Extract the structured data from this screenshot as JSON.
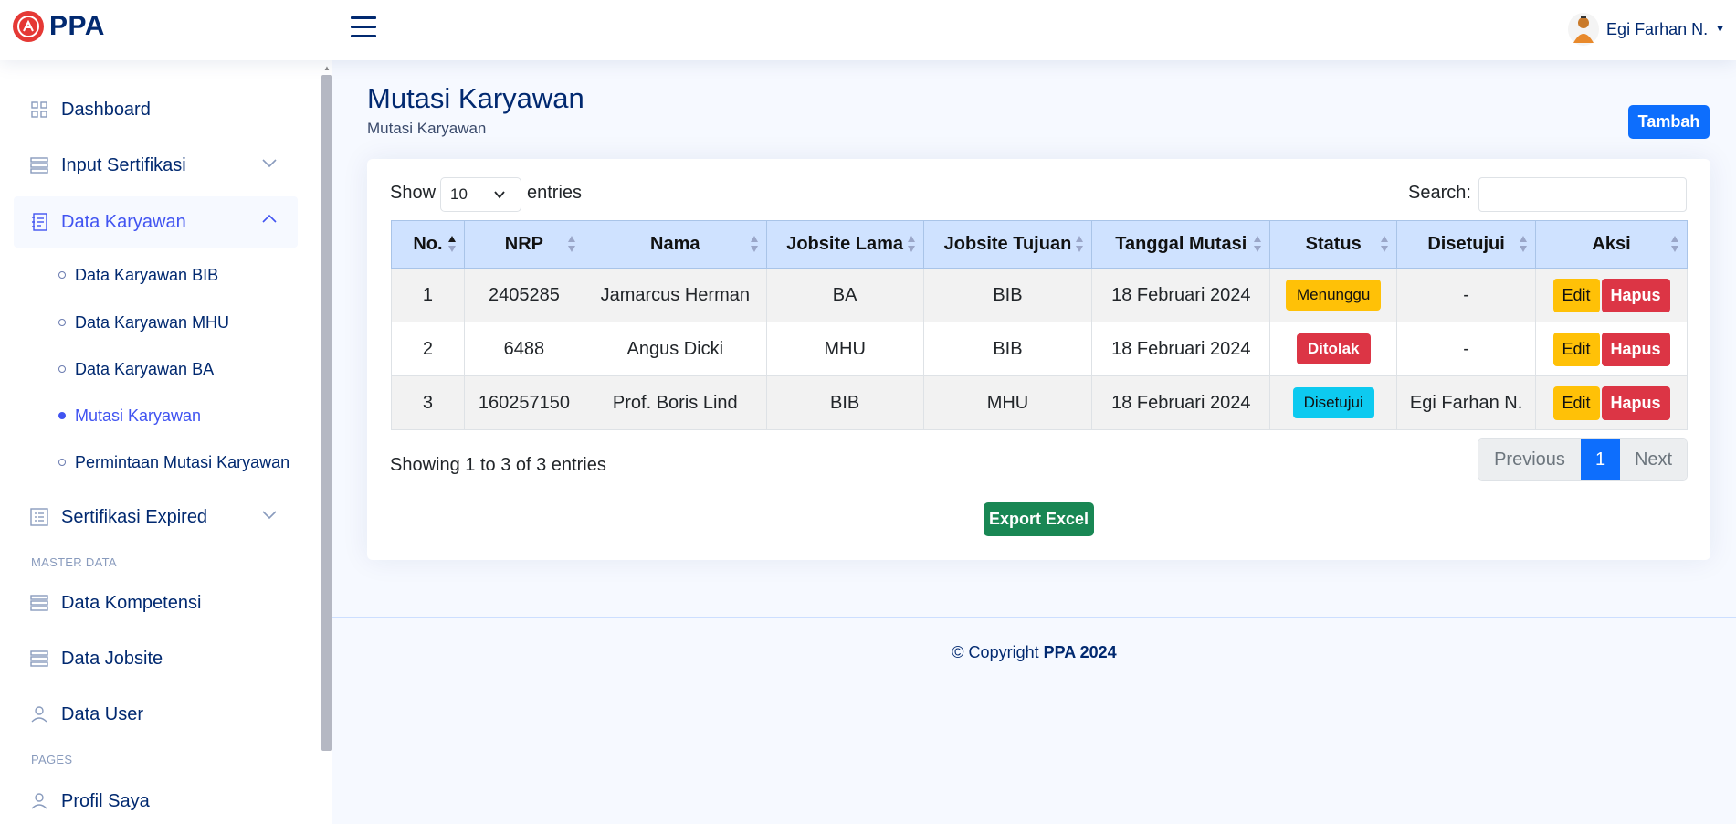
{
  "header": {
    "brand": "PPA",
    "user_name": "Egi Farhan N."
  },
  "sidebar": {
    "items": [
      {
        "label": "Dashboard",
        "icon": "grid-icon"
      },
      {
        "label": "Input Sertifikasi",
        "icon": "server-icon"
      },
      {
        "label": "Data Karyawan",
        "icon": "journal-icon"
      },
      {
        "label": "Sertifikasi Expired",
        "icon": "list-icon"
      }
    ],
    "sub_items": [
      {
        "label": "Data Karyawan BIB"
      },
      {
        "label": "Data Karyawan MHU"
      },
      {
        "label": "Data Karyawan BA"
      },
      {
        "label": "Mutasi Karyawan"
      },
      {
        "label": "Permintaan Mutasi Karyawan"
      }
    ],
    "master_heading": "MASTER DATA",
    "master_items": [
      {
        "label": "Data Kompetensi",
        "icon": "server-icon"
      },
      {
        "label": "Data Jobsite",
        "icon": "server-icon"
      },
      {
        "label": "Data User",
        "icon": "person-icon"
      }
    ],
    "pages_heading": "PAGES",
    "pages_items": [
      {
        "label": "Profil Saya",
        "icon": "person-icon"
      }
    ]
  },
  "main": {
    "title": "Mutasi Karyawan",
    "subtitle": "Mutasi Karyawan",
    "add_button": "Tambah"
  },
  "table_controls": {
    "show_label": "Show",
    "entries_value": "10",
    "entries_label": "entries",
    "search_label": "Search:"
  },
  "table": {
    "headers": [
      "No.",
      "NRP",
      "Nama",
      "Jobsite Lama",
      "Jobsite Tujuan",
      "Tanggal Mutasi",
      "Status",
      "Disetujui",
      "Aksi"
    ],
    "rows": [
      {
        "no": "1",
        "nrp": "2405285",
        "nama": "Jamarcus Herman",
        "lama": "BA",
        "tujuan": "BIB",
        "tanggal": "18 Februari 2024",
        "status": "Menunggu",
        "disetujui": "-"
      },
      {
        "no": "2",
        "nrp": "6488",
        "nama": "Angus Dicki",
        "lama": "MHU",
        "tujuan": "BIB",
        "tanggal": "18 Februari 2024",
        "status": "Ditolak",
        "disetujui": "-"
      },
      {
        "no": "3",
        "nrp": "160257150",
        "nama": "Prof. Boris Lind",
        "lama": "BIB",
        "tujuan": "MHU",
        "tanggal": "18 Februari 2024",
        "status": "Disetujui",
        "disetujui": "Egi Farhan N."
      }
    ],
    "edit_label": "Edit",
    "delete_label": "Hapus"
  },
  "footer_controls": {
    "showing": "Showing 1 to 3 of 3 entries",
    "prev": "Previous",
    "page": "1",
    "next": "Next",
    "export": "Export Excel"
  },
  "footer": {
    "copyright": "© Copyright",
    "brand_year": "PPA 2024"
  },
  "colors": {
    "primary": "#0d6efd",
    "navy": "#012970",
    "active_nav": "#4154f1",
    "table_header": "#cfe2ff",
    "warning": "#ffc107",
    "danger": "#dc3545",
    "info": "#0dcaf0",
    "success": "#198754"
  }
}
